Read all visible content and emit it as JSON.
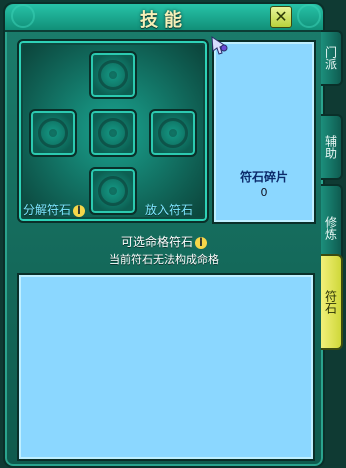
{
  "window": {
    "title": "技能"
  },
  "rune_board": {
    "decompose_label": "分解符石",
    "insert_label": "放入符石"
  },
  "shard_panel": {
    "title": "符石碎片",
    "count": "0"
  },
  "selectable": {
    "title": "可选命格符石",
    "message": "当前符石无法构成命格"
  },
  "side_tabs": [
    {
      "label": "门派"
    },
    {
      "label": "辅助"
    },
    {
      "label": "修炼"
    },
    {
      "label": "符石"
    }
  ],
  "colors": {
    "panel_blue": "#8bd7ff",
    "frame_green": "#1b7d6c",
    "active_tab": "#f2f07a",
    "accent_cyan": "#7ee6ff"
  },
  "icons": {
    "close": "close-x-icon",
    "info": "info-icon",
    "cursor": "pen-cursor-icon",
    "slot": "swirl-rune-icon"
  }
}
